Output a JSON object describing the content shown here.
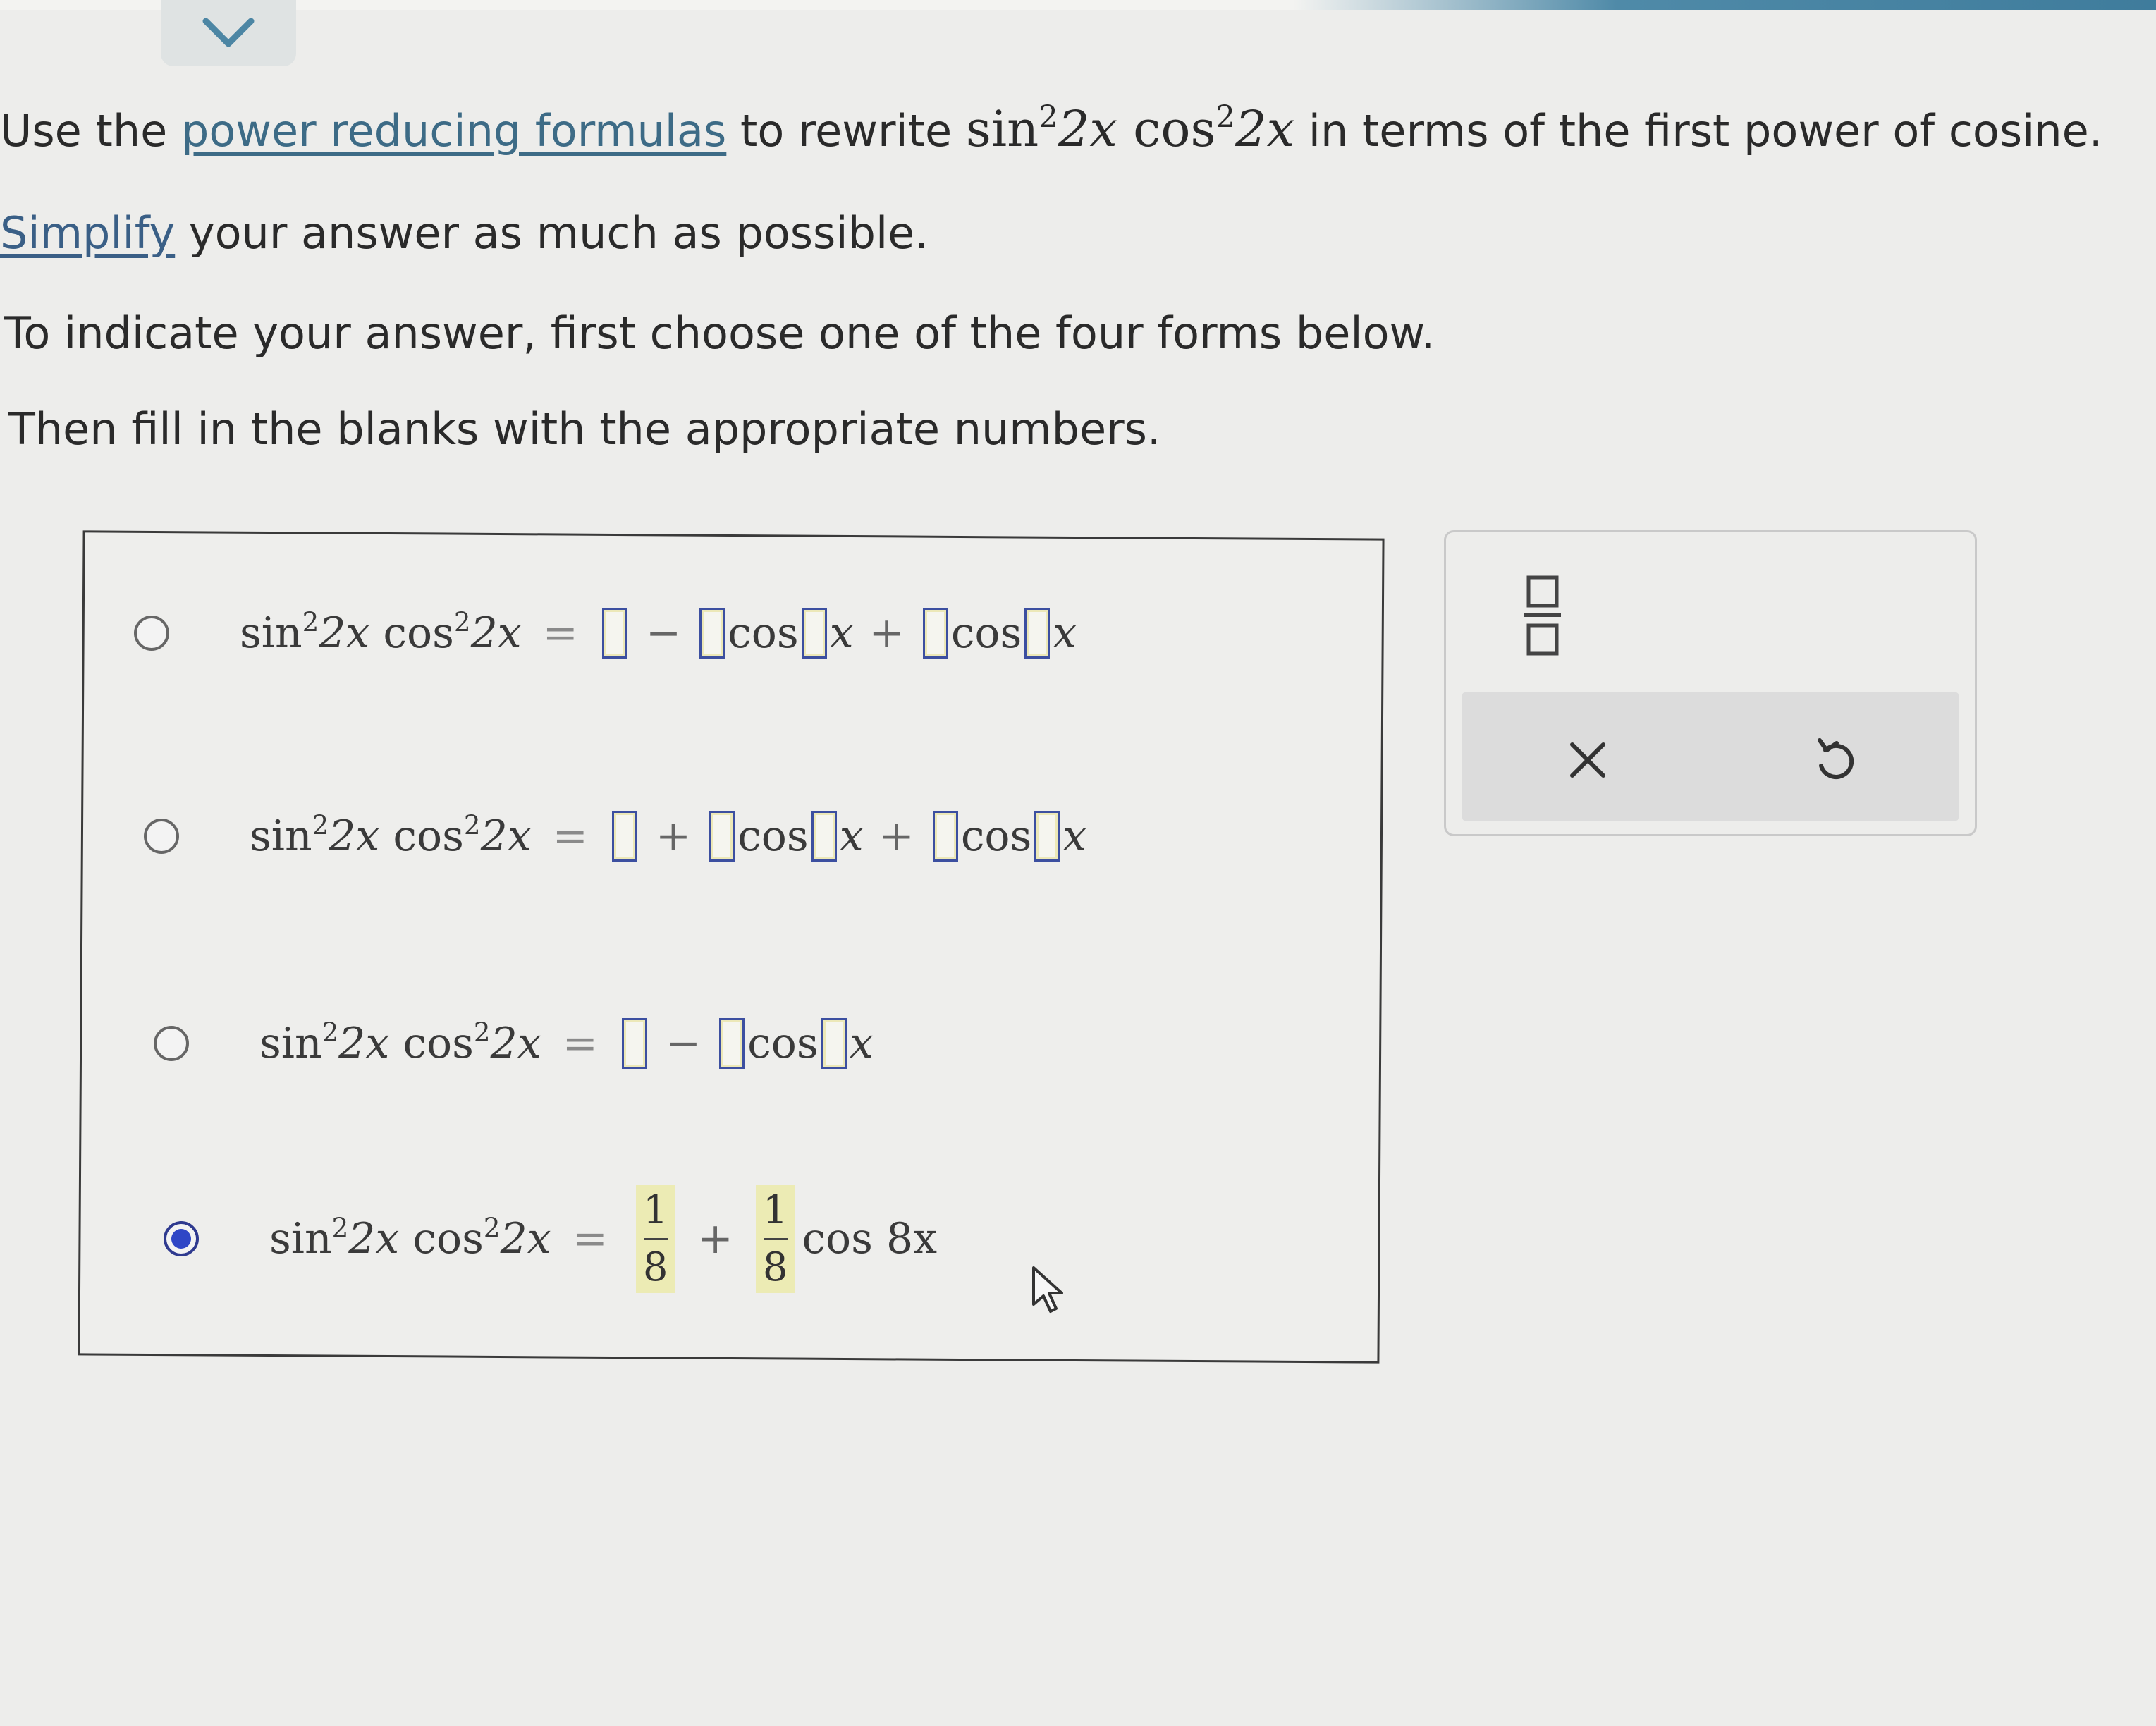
{
  "question": {
    "line1_prefix": "Use the ",
    "line1_link": "power reducing formulas",
    "line1_mid": " to rewrite ",
    "line1_suffix": " in terms of the first power of cosine.",
    "line2_link": "Simplify",
    "line2_rest": " your answer as much as possible.",
    "line3": "To indicate your answer, first choose one of the four forms below.",
    "line4": "Then fill in the blanks with the appropriate numbers."
  },
  "math": {
    "sin": "sin",
    "cos": "cos",
    "exp": "2",
    "arg": "2x",
    "equals": "=",
    "plus": "+",
    "minus": "−",
    "var_x": "x"
  },
  "options": [
    {
      "form": "□ − □cos□x + □cos□x",
      "selected": false
    },
    {
      "form": "□ + □cos□x + □cos□x",
      "selected": false
    },
    {
      "form": "□ − □cos□x",
      "selected": false
    },
    {
      "form": "1/8 + 1/8 cos 8x",
      "selected": true
    }
  ],
  "answer": {
    "term1_num": "1",
    "term1_den": "8",
    "term2_num": "1",
    "term2_den": "8",
    "cos_term": "cos 8x"
  },
  "tools": {
    "fraction_icon": "fraction-icon",
    "clear_icon": "close-icon",
    "undo_icon": "undo-icon"
  },
  "colors": {
    "link": "#3d6b86",
    "blank_border": "#3c4fa0",
    "filled_highlight": "#ecebb4",
    "radio_selected": "#2f46c6"
  }
}
